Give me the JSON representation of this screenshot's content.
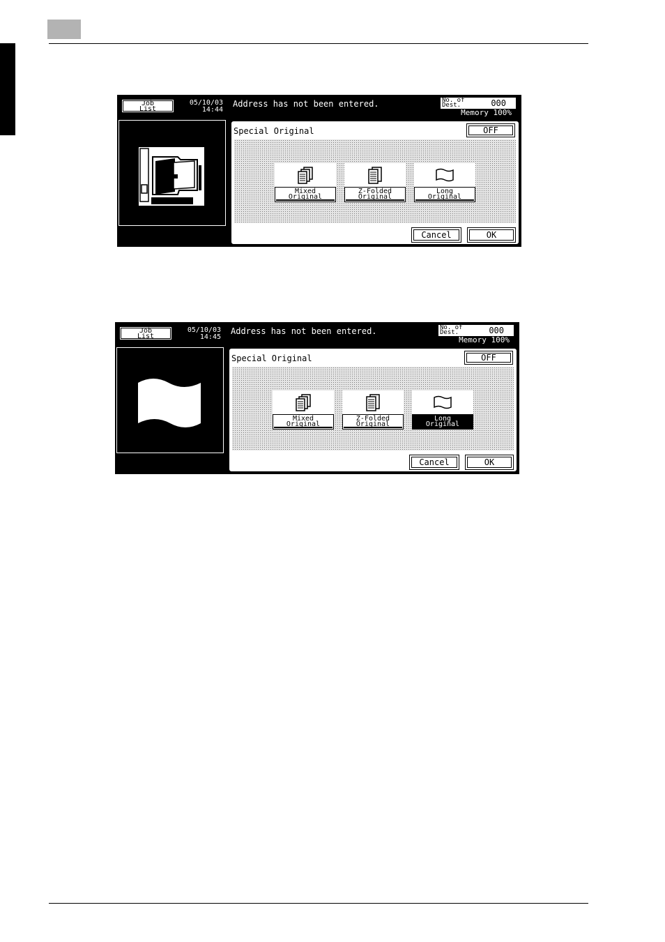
{
  "screens": [
    {
      "job_list_label": [
        "Job",
        "List"
      ],
      "date": "05/10/03",
      "time": "14:44",
      "status_message": "Address has not been entered.",
      "dest_label": [
        "No. of",
        "Dest."
      ],
      "dest_count": "000",
      "memory": "Memory 100%",
      "dialog_title": "Special Original",
      "off_label": "OFF",
      "options": [
        {
          "label": [
            "Mixed",
            "Original"
          ],
          "icon": "mixed-original-icon",
          "selected": false
        },
        {
          "label": [
            "Z-Folded",
            "Original"
          ],
          "icon": "z-folded-original-icon",
          "selected": false
        },
        {
          "label": [
            "Long",
            "Original"
          ],
          "icon": "long-original-icon",
          "selected": false
        }
      ],
      "cancel_label": "Cancel",
      "ok_label": "OK",
      "preview_icon": "adf-feeder-icon"
    },
    {
      "job_list_label": [
        "Job",
        "List"
      ],
      "date": "05/10/03",
      "time": "14:45",
      "status_message": "Address has not been entered.",
      "dest_label": [
        "No. of",
        "Dest."
      ],
      "dest_count": "000",
      "memory": "Memory 100%",
      "dialog_title": "Special Original",
      "off_label": "OFF",
      "options": [
        {
          "label": [
            "Mixed",
            "Original"
          ],
          "icon": "mixed-original-icon",
          "selected": false
        },
        {
          "label": [
            "Z-Folded",
            "Original"
          ],
          "icon": "z-folded-original-icon",
          "selected": false
        },
        {
          "label": [
            "Long",
            "Original"
          ],
          "icon": "long-original-icon",
          "selected": true
        }
      ],
      "cancel_label": "Cancel",
      "ok_label": "OK",
      "preview_icon": "long-page-icon"
    }
  ]
}
